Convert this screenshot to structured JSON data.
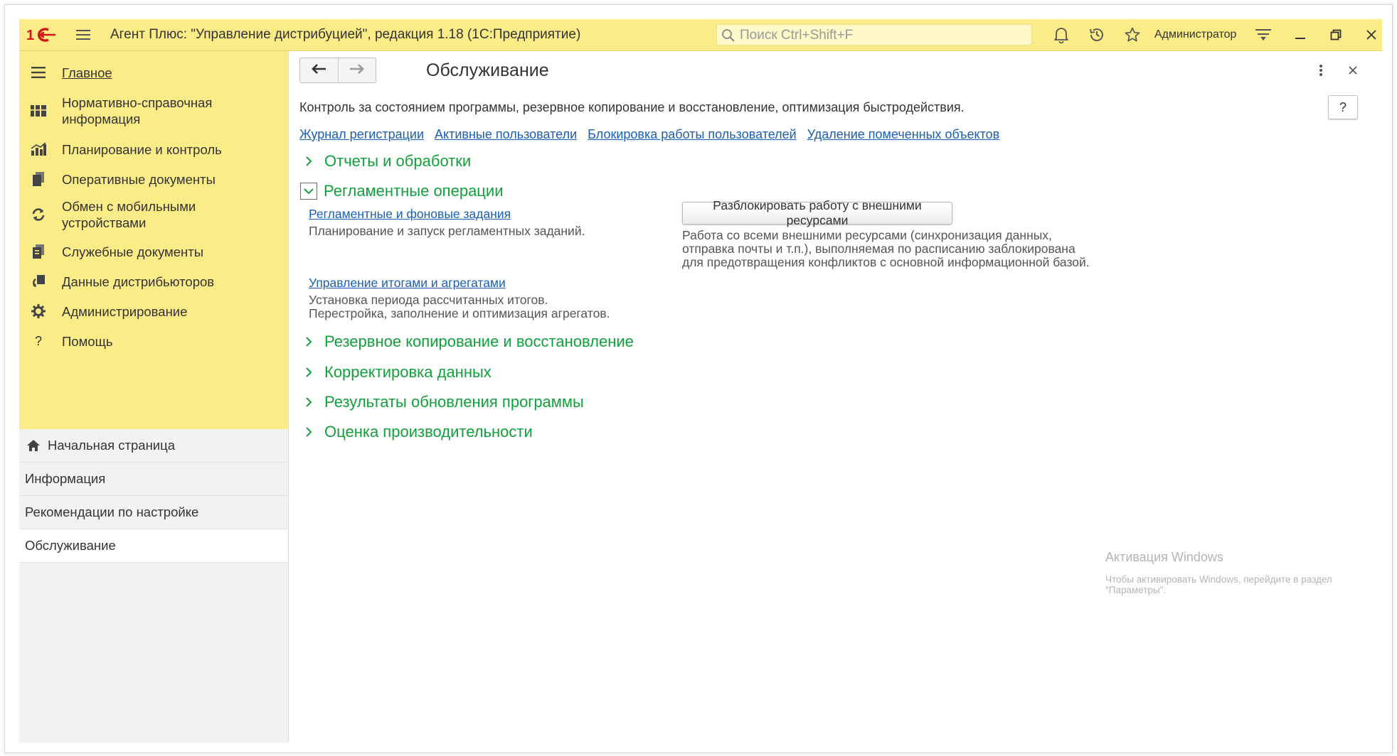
{
  "titlebar": {
    "logo": "1С",
    "title": "Агент Плюс: \"Управление дистрибуцией\", редакция 1.18  (1С:Предприятие)",
    "search_placeholder": "Поиск Ctrl+Shift+F",
    "user": "Администратор"
  },
  "sidebar": {
    "sections": [
      {
        "label": "Главное",
        "icon": "menu-icon"
      },
      {
        "label": "Нормативно-справочная информация",
        "icon": "catalog-icon"
      },
      {
        "label": "Планирование и контроль",
        "icon": "bar-chart-icon"
      },
      {
        "label": "Оперативные документы",
        "icon": "documents-icon"
      },
      {
        "label": "Обмен с мобильными устройствами",
        "icon": "sync-icon"
      },
      {
        "label": "Служебные документы",
        "icon": "service-docs-icon"
      },
      {
        "label": "Данные дистрибьюторов",
        "icon": "distributor-icon"
      },
      {
        "label": "Администрирование",
        "icon": "gear-icon"
      },
      {
        "label": "Помощь",
        "icon": "question-icon"
      }
    ],
    "pages": [
      {
        "label": "Начальная страница",
        "icon": "home-icon"
      },
      {
        "label": "Информация"
      },
      {
        "label": "Рекомендации по настройке"
      },
      {
        "label": "Обслуживание"
      }
    ]
  },
  "main": {
    "title": "Обслуживание",
    "help_label": "?",
    "description": "Контроль за состоянием программы, резервное копирование и восстановление, оптимизация быстродействия.",
    "links": [
      "Журнал регистрации",
      "Активные пользователи",
      "Блокировка работы пользователей",
      "Удаление помеченных объектов"
    ],
    "groups": [
      {
        "title": "Отчеты и обработки",
        "expanded": false
      },
      {
        "title": "Регламентные операции",
        "expanded": true
      },
      {
        "title": "Резервное копирование и восстановление",
        "expanded": false
      },
      {
        "title": "Корректировка данных",
        "expanded": false
      },
      {
        "title": "Результаты обновления программы",
        "expanded": false
      },
      {
        "title": "Оценка производительности",
        "expanded": false
      }
    ],
    "scheduled": {
      "jobs_link": "Регламентные и фоновые задания",
      "jobs_text": "Планирование и запуск регламентных заданий.",
      "totals_link": "Управление итогами и агрегатами",
      "totals_text_1": "Установка периода рассчитанных итогов.",
      "totals_text_2": "Перестройка, заполнение и оптимизация агрегатов.",
      "unblock_button": "Разблокировать работу с внешними ресурсами",
      "unblock_text_1": "Работа со всеми внешними ресурсами (синхронизация данных,",
      "unblock_text_2": "отправка почты и т.п.), выполняемая по расписанию заблокирована",
      "unblock_text_3": "для предотвращения конфликтов с основной информационной базой."
    }
  },
  "watermark": {
    "title": "Активация Windows",
    "text": "Чтобы активировать Windows, перейдите в раздел \"Параметры\"."
  },
  "colors": {
    "titlebar_bg": "#fbec88",
    "group_title": "#11a13c",
    "link": "#1a5fb4",
    "logo_red": "#d4141b"
  }
}
